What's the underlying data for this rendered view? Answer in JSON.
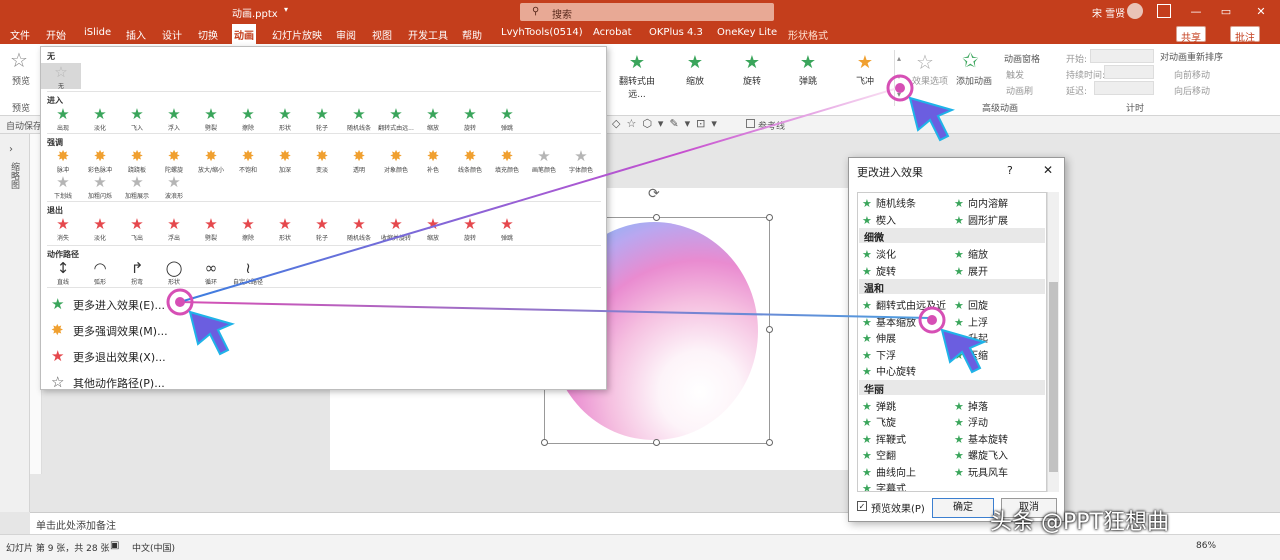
{
  "window": {
    "title": "动画.pptx",
    "search": "搜索",
    "user": "宋 雪贤",
    "min": "—",
    "max": "□",
    "close": "✕",
    "restore": "▭"
  },
  "tabs": [
    "文件",
    "开始",
    "iSlide",
    "插入",
    "设计",
    "切换",
    "动画",
    "幻灯片放映",
    "审阅",
    "视图",
    "开发工具",
    "帮助",
    "LvyhTools(0514)",
    "Acrobat",
    "OKPlus 4.3",
    "OneKey Lite",
    "形状格式"
  ],
  "share": "共享",
  "comment": "批注",
  "ribbon": {
    "preview": "预览",
    "preview_group": "预览",
    "autosave": "自动保存",
    "gallery": [
      {
        "label": "翻转式由远..."
      },
      {
        "label": "缩放"
      },
      {
        "label": "旋转"
      },
      {
        "label": "弹跳"
      },
      {
        "label": "飞冲"
      }
    ],
    "effect_options": "效果选项",
    "add_animation": "添加动画",
    "anim_pane": "动画窗格",
    "trigger": "触发",
    "anim_brush": "动画刷",
    "adv_group": "高级动画",
    "start": "开始:",
    "duration": "持续时间:",
    "delay": "延迟:",
    "timing_group": "计时",
    "reorder": "对动画重新排序",
    "move_earlier": "向前移动",
    "move_later": "向后移动",
    "ref_line": "参考线"
  },
  "panel": {
    "none_header": "无",
    "none_label": "无",
    "entrance_header": "进入",
    "entrance": [
      "出现",
      "淡化",
      "飞入",
      "浮入",
      "劈裂",
      "擦除",
      "形状",
      "轮子",
      "随机线条",
      "翻转式由远...",
      "缩放",
      "旋转",
      "弹跳"
    ],
    "emphasis_header": "强调",
    "emphasis": [
      "脉冲",
      "彩色脉冲",
      "跷跷板",
      "陀螺旋",
      "放大/缩小",
      "不饱和",
      "加深",
      "变淡",
      "透明",
      "对象颜色",
      "补色",
      "线条颜色",
      "填充颜色",
      "画笔颜色",
      "字体颜色",
      "下划线",
      "加粗闪烁",
      "加粗展示",
      "波浪形"
    ],
    "exit_header": "退出",
    "exit": [
      "消失",
      "淡化",
      "飞出",
      "浮出",
      "劈裂",
      "擦除",
      "形状",
      "轮子",
      "随机线条",
      "收缩并旋转",
      "缩放",
      "旋转",
      "弹跳"
    ],
    "path_header": "动作路径",
    "paths": [
      "直线",
      "弧形",
      "拐弯",
      "形状",
      "循环",
      "自定义路径"
    ],
    "more": [
      "更多进入效果(E)...",
      "更多强调效果(M)...",
      "更多退出效果(X)...",
      "其他动作路径(P)..."
    ]
  },
  "dialog": {
    "title": "更改进入效果",
    "help": "?",
    "close": "✕",
    "rows_top": [
      [
        "随机线条",
        "向内溶解"
      ],
      [
        "楔入",
        "圆形扩展"
      ]
    ],
    "cat1": "细微",
    "cat1_rows": [
      [
        "淡化",
        "缩放"
      ],
      [
        "旋转",
        "展开"
      ]
    ],
    "cat2": "温和",
    "cat2_rows": [
      [
        "翻转式由远及近",
        "回旋"
      ],
      [
        "基本缩放",
        "上浮"
      ],
      [
        "伸展",
        "升起"
      ],
      [
        "下浮",
        "压缩"
      ],
      [
        "中心旋转",
        ""
      ]
    ],
    "cat3": "华丽",
    "cat3_rows": [
      [
        "弹跳",
        "掉落"
      ],
      [
        "飞旋",
        "浮动"
      ],
      [
        "挥鞭式",
        "基本旋转"
      ],
      [
        "空翻",
        "螺旋飞入"
      ],
      [
        "曲线向上",
        "玩具风车"
      ],
      [
        "字幕式",
        ""
      ]
    ],
    "preview_label": "预览效果(P)",
    "ok": "确定",
    "cancel": "取消"
  },
  "notes": "单击此处添加备注",
  "status": {
    "slide": "幻灯片 第 9 张，共 28 张",
    "lang": "中文(中国)",
    "notes_btn": "备注",
    "zoom": "86%"
  },
  "thumbnail_label": "缩略图",
  "watermark": "头条 @PPT狂想曲"
}
